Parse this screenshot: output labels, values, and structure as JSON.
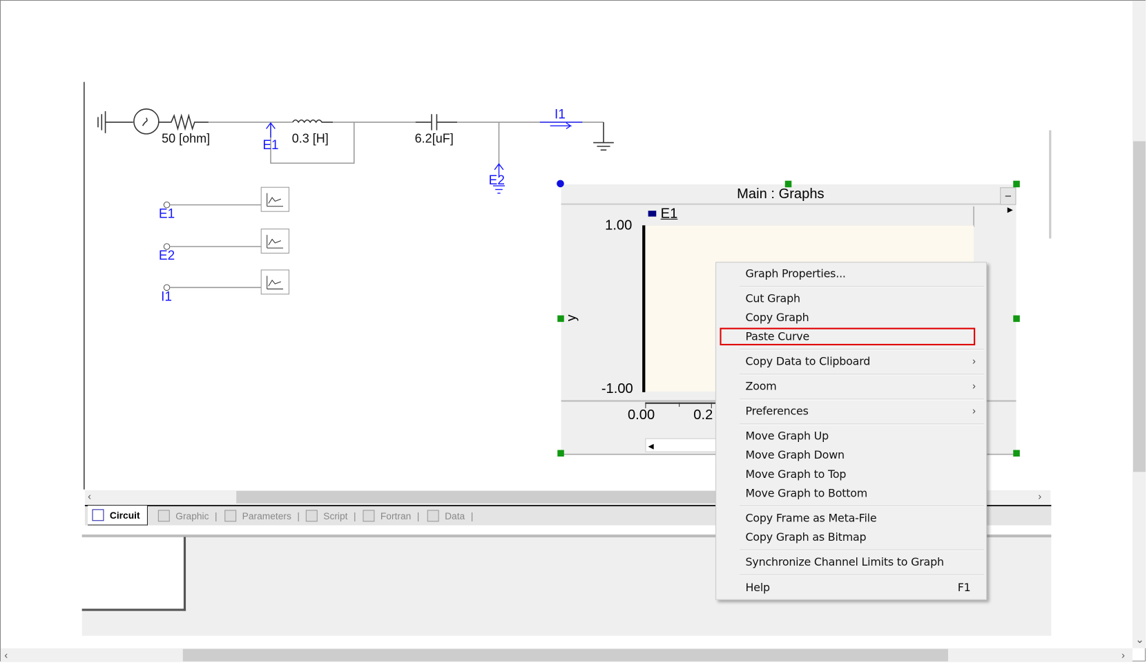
{
  "circuit": {
    "resistor": "50 [ohm]",
    "inductor": "0.3 [H]",
    "capacitor": "6.2[uF]",
    "meters": [
      "E1",
      "E2",
      "I1"
    ],
    "plot_inputs": [
      "E1",
      "E2",
      "I1"
    ]
  },
  "tabs": [
    {
      "label": "Circuit",
      "active": true
    },
    {
      "label": "Graphic"
    },
    {
      "label": "Parameters"
    },
    {
      "label": "Script"
    },
    {
      "label": "Fortran"
    },
    {
      "label": "Data"
    }
  ],
  "graph": {
    "title": "Main : Graphs",
    "legend": "E1",
    "legend_color": "#000080",
    "ylabel": "y",
    "y_ticks": [
      "1.00",
      "-1.00"
    ],
    "x_ticks": [
      "0.00",
      "0.2"
    ],
    "minimize": "–"
  },
  "context_menu": {
    "items": [
      {
        "label": "Graph Properties..."
      },
      {
        "label": "Cut Graph"
      },
      {
        "label": "Copy Graph"
      },
      {
        "label": "Paste Curve",
        "highlighted": true
      },
      {
        "label": "Copy Data to Clipboard",
        "submenu": true
      },
      {
        "label": "Zoom",
        "submenu": true
      },
      {
        "label": "Preferences",
        "submenu": true
      },
      {
        "label": "Move Graph Up"
      },
      {
        "label": "Move Graph Down"
      },
      {
        "label": "Move Graph to Top"
      },
      {
        "label": "Move Graph to Bottom"
      },
      {
        "label": "Copy Frame as Meta-File"
      },
      {
        "label": "Copy Graph as Bitmap"
      },
      {
        "label": "Synchronize Channel Limits to Graph"
      },
      {
        "label": "Help",
        "shortcut": "F1"
      }
    ]
  },
  "colors": {
    "highlight_border": "#e00000",
    "handle": "#119911",
    "label_blue": "#1a1aff"
  }
}
